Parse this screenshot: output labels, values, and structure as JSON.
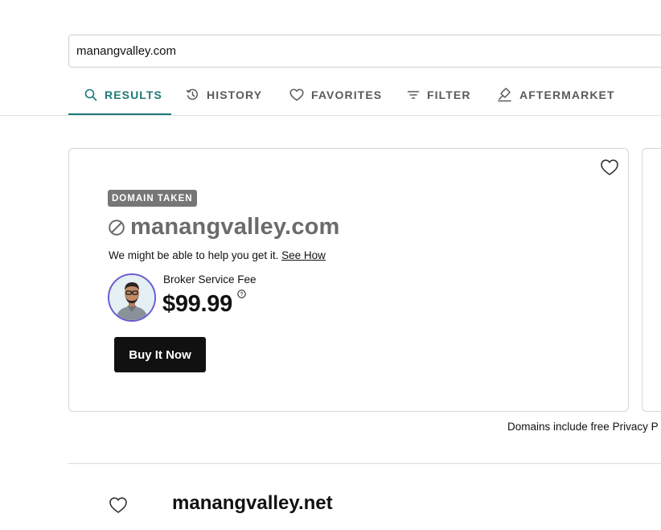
{
  "search": {
    "value": "manangvalley.com"
  },
  "tabs": [
    {
      "label": "RESULTS",
      "icon": "search-icon",
      "active": true
    },
    {
      "label": "HISTORY",
      "icon": "history-icon",
      "active": false
    },
    {
      "label": "FAVORITES",
      "icon": "heart-icon",
      "active": false
    },
    {
      "label": "FILTER",
      "icon": "filter-icon",
      "active": false
    },
    {
      "label": "AFTERMARKET",
      "icon": "gavel-icon",
      "active": false
    }
  ],
  "result_card": {
    "badge": "DOMAIN TAKEN",
    "domain": "manangvalley.com",
    "help_text": "We might be able to help you get it.",
    "see_how": "See How",
    "fee_label": "Broker Service Fee",
    "price": "$99.99",
    "buy_label": "Buy It Now"
  },
  "privacy_note": "Domains include free Privacy P",
  "next_result": {
    "domain": "manangvalley.net"
  },
  "colors": {
    "accent": "#1d7a78",
    "badge": "#767676",
    "button": "#111111",
    "avatar_ring": "#6b5bd2"
  }
}
